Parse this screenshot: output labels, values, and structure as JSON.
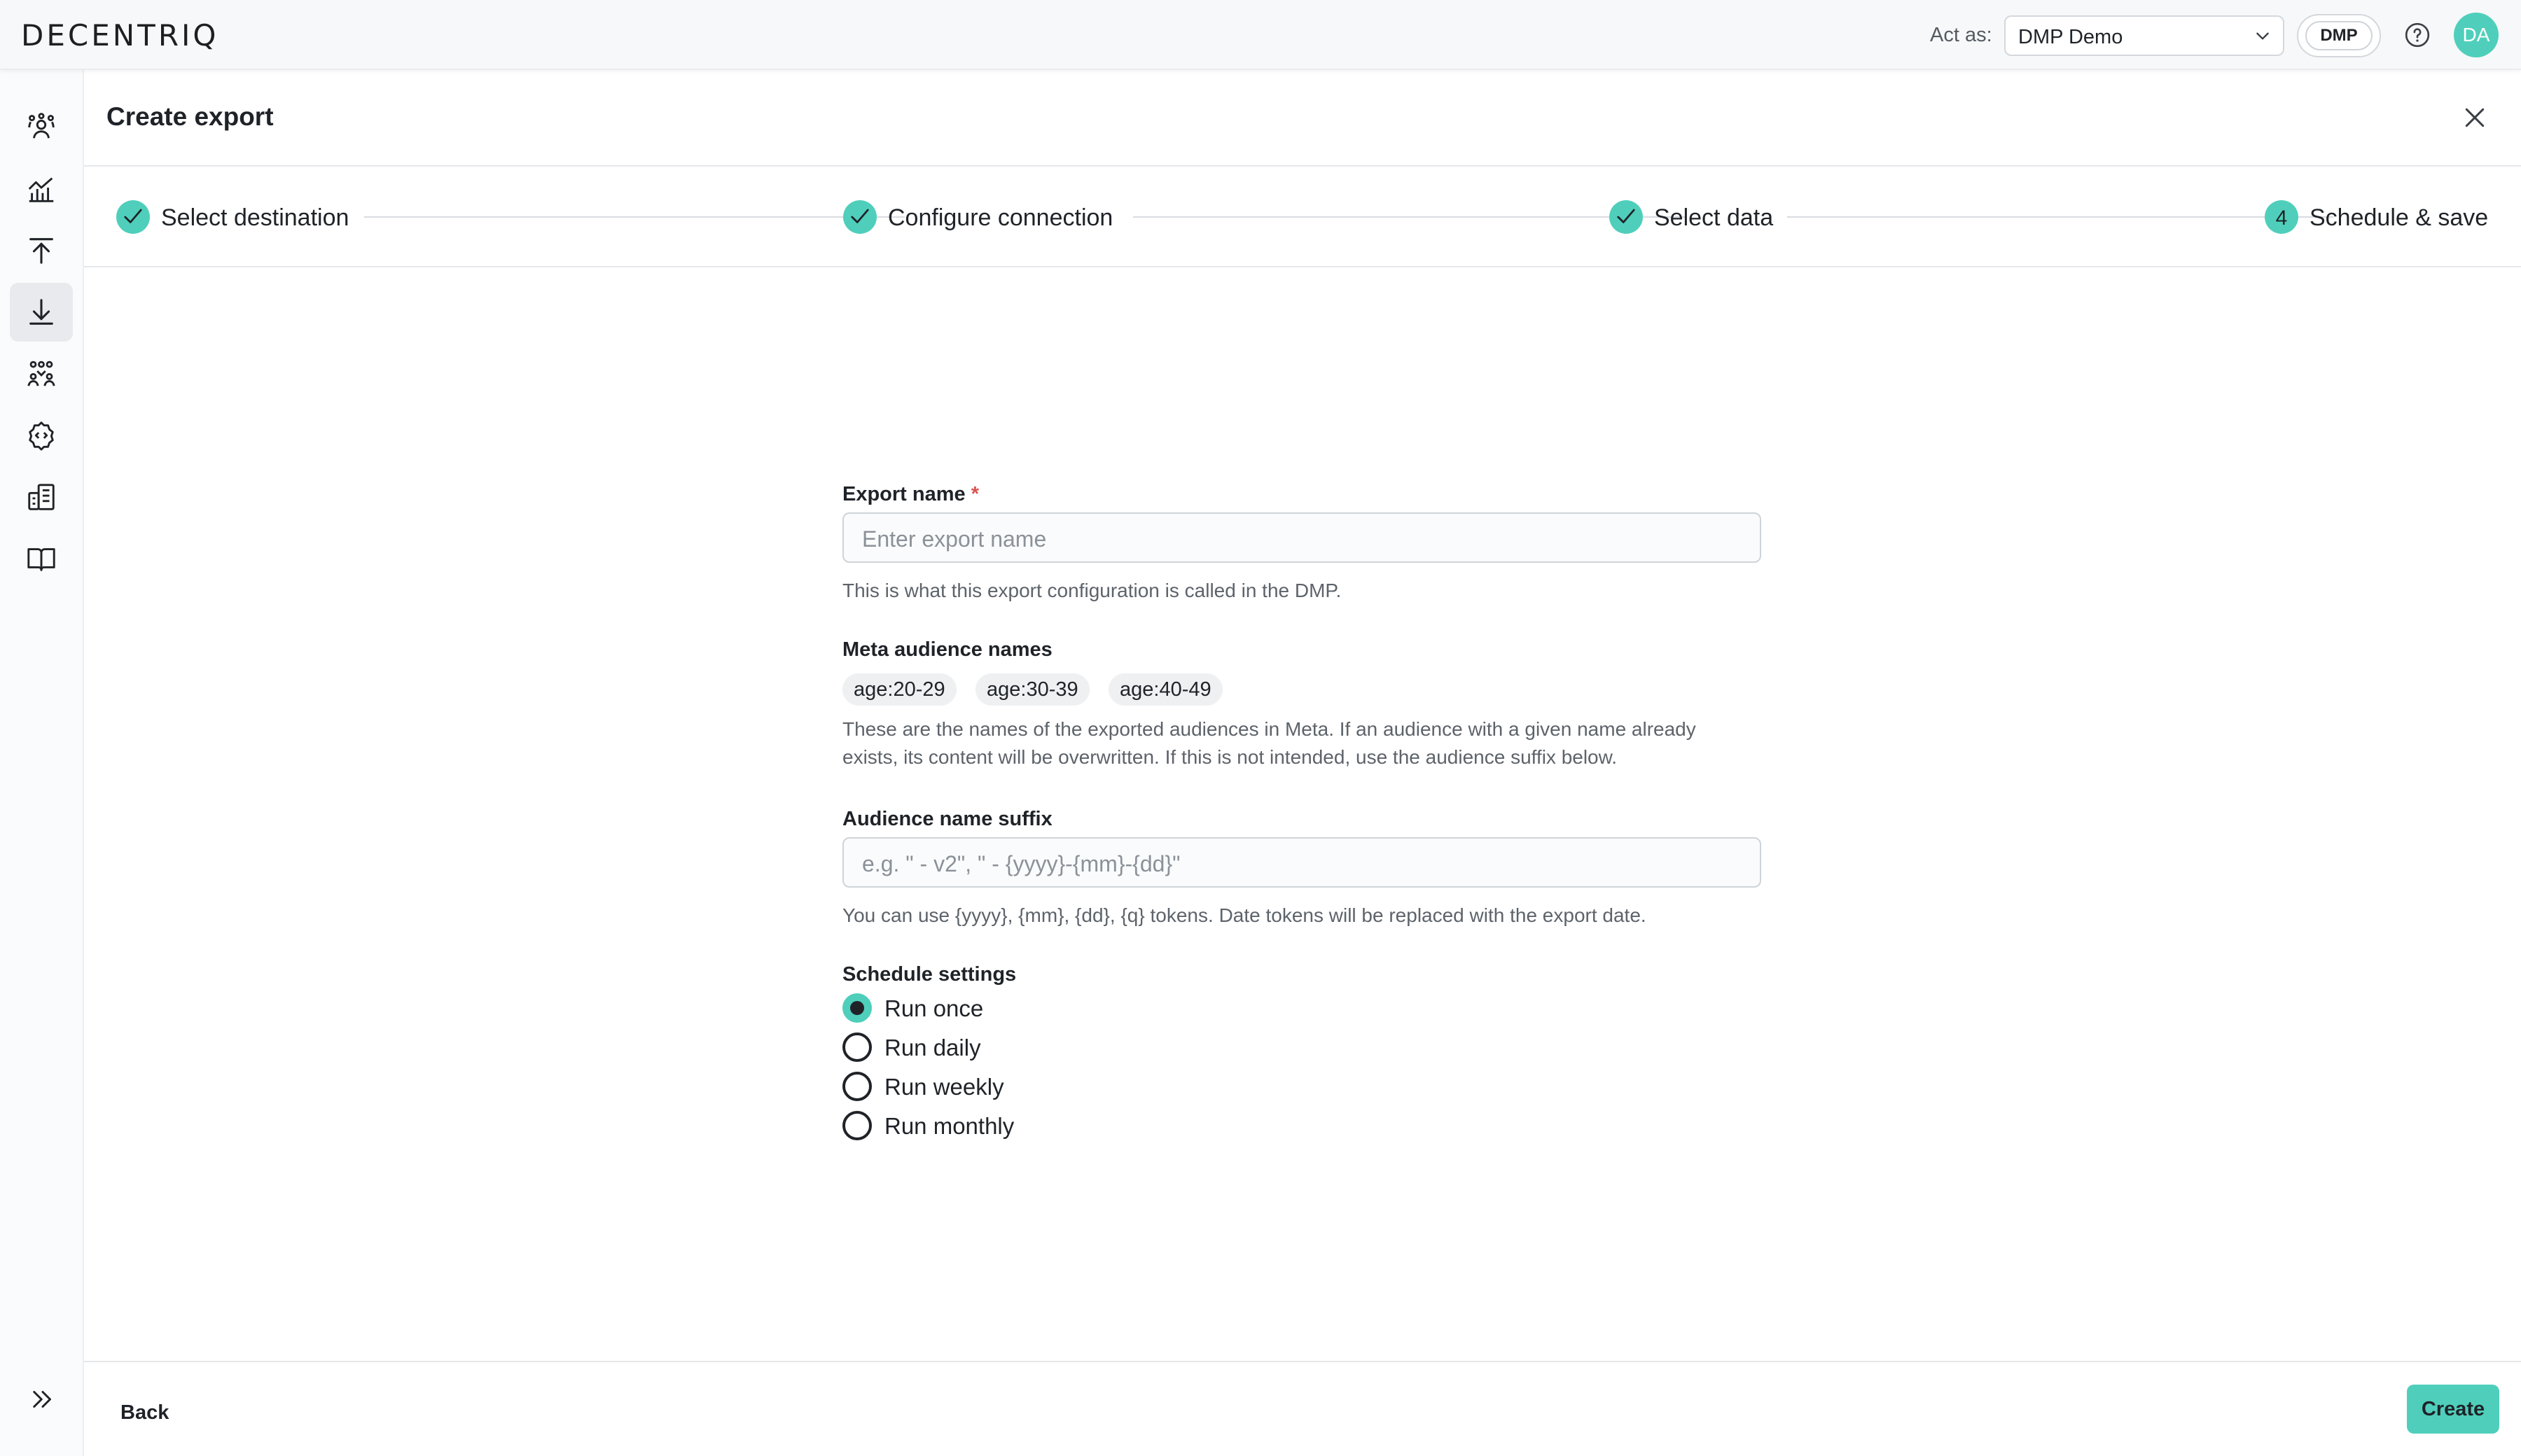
{
  "app": {
    "logo": "DECENTRIQ"
  },
  "topbar": {
    "act_as_label": "Act as:",
    "act_as_value": "DMP Demo",
    "badge": "DMP",
    "avatar_initials": "DA"
  },
  "sidebar": {
    "items": [
      {
        "icon": "audiences-icon",
        "active": false
      },
      {
        "icon": "insights-chart-icon",
        "active": false
      },
      {
        "icon": "upload-icon",
        "active": false
      },
      {
        "icon": "download-icon",
        "active": true
      },
      {
        "icon": "users-group-icon",
        "active": false
      },
      {
        "icon": "settings-code-icon",
        "active": false
      },
      {
        "icon": "organization-icon",
        "active": false
      },
      {
        "icon": "docs-book-icon",
        "active": false
      }
    ],
    "expand_icon": "expand-icon"
  },
  "header": {
    "title": "Create export"
  },
  "stepper": {
    "steps": [
      {
        "label": "Select destination",
        "state": "done"
      },
      {
        "label": "Configure connection",
        "state": "done"
      },
      {
        "label": "Select data",
        "state": "done"
      },
      {
        "label": "Schedule & save",
        "state": "current",
        "number": "4"
      }
    ]
  },
  "form": {
    "export_name": {
      "label": "Export name",
      "required_mark": "*",
      "placeholder": "Enter export name",
      "value": "",
      "helper": "This is what this export configuration is called in the DMP."
    },
    "meta_audiences": {
      "label": "Meta audience names",
      "chips": [
        "age:20-29",
        "age:30-39",
        "age:40-49"
      ],
      "helper_line1": "These are the names of the exported audiences in Meta. If an audience with a given name already",
      "helper_line2": "exists, its content will be overwritten. If this is not intended, use the audience suffix below."
    },
    "suffix": {
      "label": "Audience name suffix",
      "placeholder": "e.g. \" - v2\", \" - {yyyy}-{mm}-{dd}\"",
      "value": "",
      "helper": "You can use {yyyy}, {mm}, {dd}, {q} tokens. Date tokens will be replaced with the export date."
    },
    "schedule": {
      "label": "Schedule settings",
      "options": [
        {
          "label": "Run once",
          "checked": true
        },
        {
          "label": "Run daily",
          "checked": false
        },
        {
          "label": "Run weekly",
          "checked": false
        },
        {
          "label": "Run monthly",
          "checked": false
        }
      ]
    }
  },
  "footer": {
    "back_label": "Back",
    "create_label": "Create"
  },
  "colors": {
    "accent": "#4fcfbb",
    "required": "#d9534f",
    "text": "#1f2328"
  }
}
